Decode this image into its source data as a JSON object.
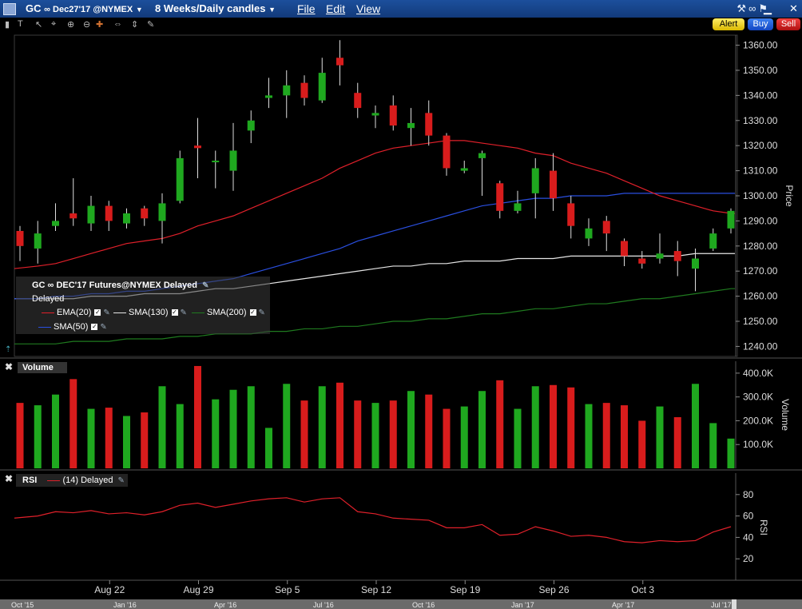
{
  "window": {
    "symbol": "GC",
    "symbol_suffix": "∞ Dec27'17 @NYMEX",
    "period": "8 Weeks/Daily candles",
    "menu": [
      "File",
      "Edit",
      "View"
    ],
    "buttons": {
      "alert": "Alert",
      "buy": "Buy",
      "sell": "Sell"
    }
  },
  "legend": {
    "title": "GC ∞ DEC'17 Futures@NYMEX Delayed",
    "status": "Delayed",
    "items": [
      {
        "name": "EMA(20)",
        "color": "#e0202a"
      },
      {
        "name": "SMA(130)",
        "color": "#e6e6e6"
      },
      {
        "name": "SMA(200)",
        "color": "#1f7a1f"
      },
      {
        "name": "SMA(50)",
        "color": "#2a4fe0"
      }
    ]
  },
  "price_axis": {
    "label": "Price",
    "ticks": [
      "1360.00",
      "1350.00",
      "1340.00",
      "1330.00",
      "1320.00",
      "1310.00",
      "1300.00",
      "1290.00",
      "1280.00",
      "1270.00",
      "1260.00",
      "1250.00",
      "1240.00"
    ]
  },
  "volume_panel": {
    "label": "Volume",
    "axis_label": "Volume",
    "ticks": [
      "400.0K",
      "300.0K",
      "200.0K",
      "100.0K"
    ]
  },
  "rsi_panel": {
    "label": "RSI",
    "series_label": "(14) Delayed",
    "axis_label": "RSI",
    "ticks": [
      "80",
      "60",
      "40",
      "20"
    ]
  },
  "x_axis": {
    "ticks": [
      "Aug 22",
      "Aug 29",
      "Sep 5",
      "Sep 12",
      "Sep 19",
      "Sep 26",
      "Oct 3"
    ]
  },
  "navigator": {
    "labels": [
      "Oct '15",
      "Jan '16",
      "Apr '16",
      "Jul '16",
      "Oct '16",
      "Jan '17",
      "Apr '17",
      "Jul '17"
    ]
  },
  "colors": {
    "up": "#1fa81f",
    "down": "#d81c1c"
  },
  "chart_data": {
    "type": "candlestick",
    "ylim": [
      1236,
      1364
    ],
    "candles": [
      {
        "o": 1286,
        "h": 1288,
        "l": 1274,
        "c": 1280
      },
      {
        "o": 1279,
        "h": 1290,
        "l": 1273,
        "c": 1285
      },
      {
        "o": 1288,
        "h": 1297,
        "l": 1286,
        "c": 1290
      },
      {
        "o": 1293,
        "h": 1307,
        "l": 1288,
        "c": 1291
      },
      {
        "o": 1289,
        "h": 1300,
        "l": 1286,
        "c": 1296
      },
      {
        "o": 1296,
        "h": 1298,
        "l": 1286,
        "c": 1290
      },
      {
        "o": 1289,
        "h": 1295,
        "l": 1287,
        "c": 1293
      },
      {
        "o": 1295,
        "h": 1296,
        "l": 1288,
        "c": 1291
      },
      {
        "o": 1290,
        "h": 1301,
        "l": 1281,
        "c": 1297
      },
      {
        "o": 1298,
        "h": 1318,
        "l": 1297,
        "c": 1315
      },
      {
        "o": 1320,
        "h": 1331,
        "l": 1307,
        "c": 1319
      },
      {
        "o": 1314,
        "h": 1318,
        "l": 1303,
        "c": 1314
      },
      {
        "o": 1310,
        "h": 1329,
        "l": 1302,
        "c": 1318
      },
      {
        "o": 1326,
        "h": 1334,
        "l": 1321,
        "c": 1330
      },
      {
        "o": 1339,
        "h": 1347,
        "l": 1335,
        "c": 1340
      },
      {
        "o": 1340,
        "h": 1350,
        "l": 1331,
        "c": 1344
      },
      {
        "o": 1345,
        "h": 1348,
        "l": 1336,
        "c": 1339
      },
      {
        "o": 1338,
        "h": 1355,
        "l": 1337,
        "c": 1349
      },
      {
        "o": 1355,
        "h": 1362,
        "l": 1344,
        "c": 1352
      },
      {
        "o": 1341,
        "h": 1345,
        "l": 1331,
        "c": 1335
      },
      {
        "o": 1332,
        "h": 1336,
        "l": 1327,
        "c": 1333
      },
      {
        "o": 1336,
        "h": 1340,
        "l": 1326,
        "c": 1328
      },
      {
        "o": 1327,
        "h": 1335,
        "l": 1320,
        "c": 1329
      },
      {
        "o": 1333,
        "h": 1338,
        "l": 1320,
        "c": 1324
      },
      {
        "o": 1324,
        "h": 1325,
        "l": 1308,
        "c": 1311
      },
      {
        "o": 1310,
        "h": 1314,
        "l": 1309,
        "c": 1311
      },
      {
        "o": 1315,
        "h": 1318,
        "l": 1300,
        "c": 1317
      },
      {
        "o": 1305,
        "h": 1306,
        "l": 1291,
        "c": 1294
      },
      {
        "o": 1294,
        "h": 1302,
        "l": 1293,
        "c": 1297
      },
      {
        "o": 1301,
        "h": 1315,
        "l": 1291,
        "c": 1311
      },
      {
        "o": 1310,
        "h": 1317,
        "l": 1294,
        "c": 1299
      },
      {
        "o": 1297,
        "h": 1300,
        "l": 1283,
        "c": 1288
      },
      {
        "o": 1283,
        "h": 1291,
        "l": 1280,
        "c": 1287
      },
      {
        "o": 1290,
        "h": 1292,
        "l": 1278,
        "c": 1285
      },
      {
        "o": 1282,
        "h": 1283,
        "l": 1272,
        "c": 1276
      },
      {
        "o": 1275,
        "h": 1278,
        "l": 1271,
        "c": 1273
      },
      {
        "o": 1275,
        "h": 1285,
        "l": 1273,
        "c": 1277
      },
      {
        "o": 1278,
        "h": 1282,
        "l": 1268,
        "c": 1274
      },
      {
        "o": 1271,
        "h": 1279,
        "l": 1262,
        "c": 1275
      },
      {
        "o": 1279,
        "h": 1287,
        "l": 1278,
        "c": 1285
      },
      {
        "o": 1287,
        "h": 1295,
        "l": 1285,
        "c": 1294
      }
    ],
    "volume": [
      275,
      265,
      310,
      375,
      250,
      255,
      220,
      235,
      345,
      270,
      430,
      290,
      330,
      345,
      170,
      355,
      285,
      345,
      360,
      285,
      275,
      285,
      325,
      310,
      250,
      260,
      325,
      370,
      250,
      345,
      350,
      340,
      270,
      275,
      265,
      200,
      260,
      215,
      355,
      190,
      125
    ],
    "ema20": [
      1271,
      1272,
      1273,
      1275,
      1277,
      1279,
      1281,
      1282,
      1283,
      1285,
      1288,
      1290,
      1292,
      1295,
      1298,
      1301,
      1304,
      1307,
      1311,
      1314,
      1317,
      1319,
      1320,
      1321,
      1322,
      1322,
      1321,
      1320,
      1319,
      1317,
      1316,
      1313,
      1311,
      1309,
      1306,
      1303,
      1300,
      1298,
      1296,
      1294,
      1293
    ],
    "sma50": [
      1259,
      1259,
      1260,
      1260,
      1261,
      1261,
      1262,
      1262,
      1263,
      1264,
      1265,
      1266,
      1267,
      1269,
      1271,
      1273,
      1275,
      1277,
      1279,
      1282,
      1284,
      1286,
      1288,
      1290,
      1292,
      1294,
      1296,
      1297,
      1298,
      1299,
      1299,
      1300,
      1300,
      1300,
      1301,
      1301,
      1301,
      1301,
      1301,
      1301,
      1301
    ],
    "sma130": [
      1259,
      1259,
      1259,
      1259,
      1260,
      1260,
      1260,
      1261,
      1261,
      1261,
      1262,
      1263,
      1263,
      1264,
      1265,
      1266,
      1267,
      1268,
      1269,
      1270,
      1271,
      1272,
      1272,
      1273,
      1273,
      1274,
      1274,
      1274,
      1275,
      1275,
      1275,
      1276,
      1276,
      1276,
      1276,
      1276,
      1276,
      1276,
      1277,
      1277,
      1277
    ],
    "sma200": [
      1241,
      1241,
      1241,
      1242,
      1242,
      1242,
      1243,
      1243,
      1243,
      1244,
      1244,
      1245,
      1245,
      1245,
      1246,
      1246,
      1247,
      1247,
      1248,
      1248,
      1249,
      1250,
      1250,
      1251,
      1251,
      1252,
      1253,
      1253,
      1254,
      1255,
      1255,
      1256,
      1257,
      1257,
      1258,
      1259,
      1259,
      1260,
      1261,
      1262,
      1263
    ],
    "rsi": [
      58,
      60,
      64,
      63,
      65,
      62,
      63,
      61,
      64,
      70,
      72,
      68,
      71,
      74,
      76,
      77,
      73,
      76,
      77,
      64,
      62,
      58,
      57,
      56,
      49,
      49,
      52,
      42,
      43,
      50,
      46,
      41,
      42,
      40,
      36,
      35,
      37,
      36,
      37,
      45,
      50
    ],
    "volume_range": [
      0,
      450
    ],
    "rsi_range": [
      0,
      100
    ]
  }
}
